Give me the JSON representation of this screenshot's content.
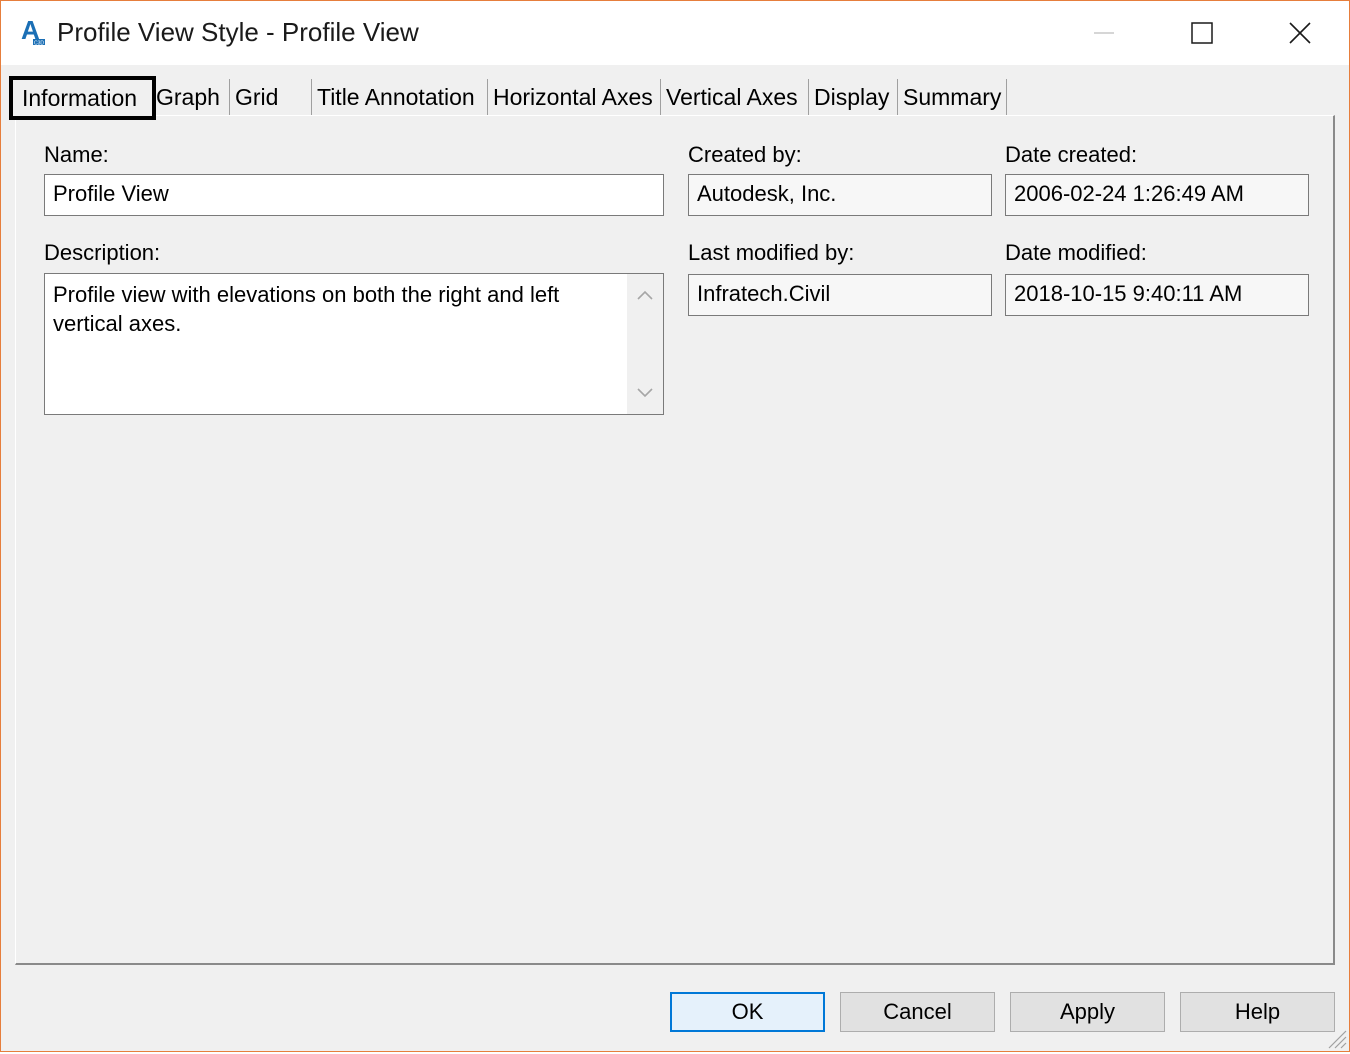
{
  "window": {
    "title": "Profile View Style - Profile View",
    "app_icon_letter": "A",
    "border_color": "#e67e3c"
  },
  "tabs": [
    {
      "label": "Information",
      "active": true
    },
    {
      "label": "Graph",
      "active": false
    },
    {
      "label": "Grid",
      "active": false
    },
    {
      "label": "Title Annotation",
      "active": false
    },
    {
      "label": "Horizontal Axes",
      "active": false
    },
    {
      "label": "Vertical Axes",
      "active": false
    },
    {
      "label": "Display",
      "active": false
    },
    {
      "label": "Summary",
      "active": false
    }
  ],
  "info": {
    "name_label": "Name:",
    "name_value": "Profile View",
    "description_label": "Description:",
    "description_value": "Profile view with elevations on both the right and left vertical axes.",
    "created_by_label": "Created by:",
    "created_by_value": "Autodesk, Inc.",
    "date_created_label": "Date created:",
    "date_created_value": "2006-02-24 1:26:49 AM",
    "last_modified_by_label": "Last modified by:",
    "last_modified_by_value": "Infratech.Civil",
    "date_modified_label": "Date modified:",
    "date_modified_value": "2018-10-15 9:40:11 AM"
  },
  "buttons": {
    "ok": "OK",
    "cancel": "Cancel",
    "apply": "Apply",
    "help": "Help"
  },
  "icons": {
    "app": "autocad-civil-icon",
    "minimize": "minimize-icon",
    "maximize": "maximize-icon",
    "close": "close-icon",
    "scroll_up": "chevron-up-icon",
    "scroll_down": "chevron-down-icon",
    "resize": "resize-grip-icon"
  },
  "colors": {
    "accent": "#0078d7",
    "default_button_bg": "#e5f1fb"
  }
}
